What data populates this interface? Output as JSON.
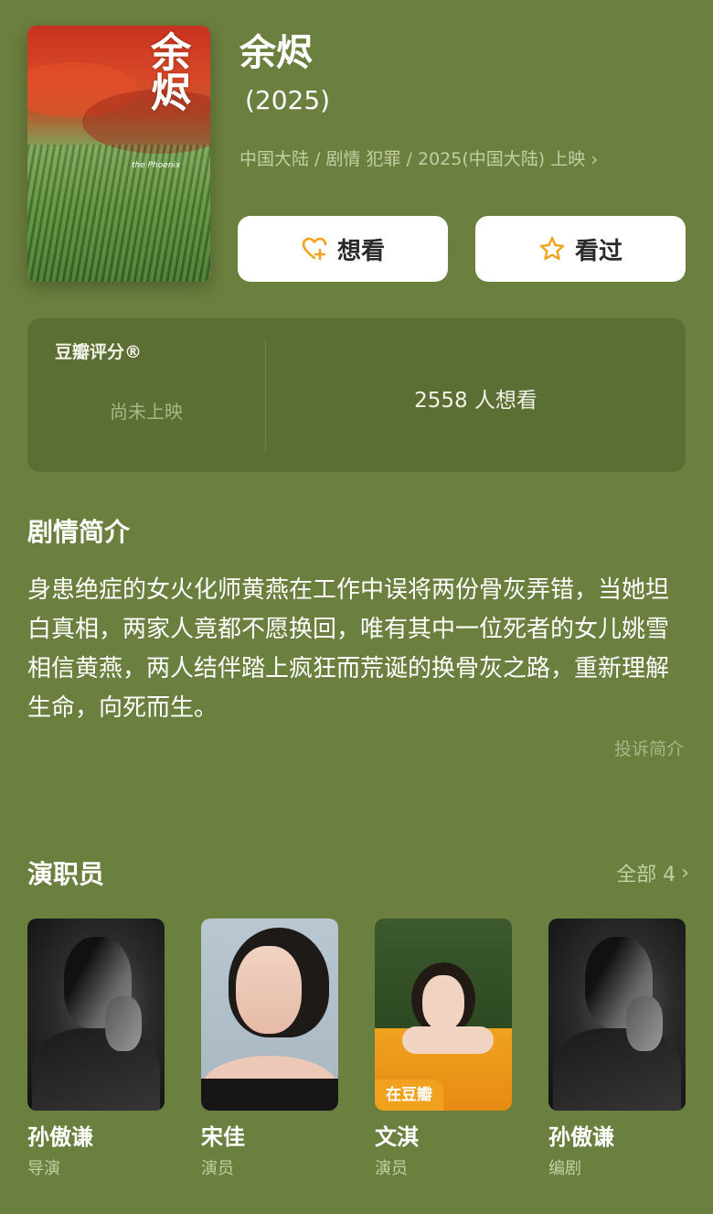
{
  "movie": {
    "poster_title": "余烬",
    "poster_subtitle": "the Phoenix",
    "title": "余烬",
    "year": "(2025)",
    "meta": "中国大陆 / 剧情 犯罪 / 2025(中国大陆) 上映"
  },
  "actions": {
    "want_label": "想看",
    "seen_label": "看过"
  },
  "rating": {
    "title": "豆瓣评分®",
    "status": "尚未上映",
    "want_count": "2558 人想看"
  },
  "synopsis": {
    "heading": "剧情简介",
    "text": "身患绝症的女火化师黄燕在工作中误将两份骨灰弄错，当她坦白真相，两家人竟都不愿换回，唯有其中一位死者的女儿姚雪相信黄燕，两人结伴踏上疯狂而荒诞的换骨灰之路，重新理解生命，向死而生。",
    "report_label": "投诉简介"
  },
  "cast": {
    "heading": "演职员",
    "all_label": "全部 4",
    "members": [
      {
        "name": "孙傲谦",
        "role": "导演"
      },
      {
        "name": "宋佳",
        "role": "演员"
      },
      {
        "name": "文淇",
        "role": "演员",
        "badge": "在豆瓣"
      },
      {
        "name": "孙傲谦",
        "role": "编剧"
      }
    ]
  },
  "colors": {
    "background": "#6b7f3e",
    "accent_orange": "#f0a21e",
    "muted_text": "#c3cea3"
  },
  "icons": {
    "want": "heart-plus-icon",
    "seen": "star-icon",
    "chevron": "chevron-right-icon"
  }
}
